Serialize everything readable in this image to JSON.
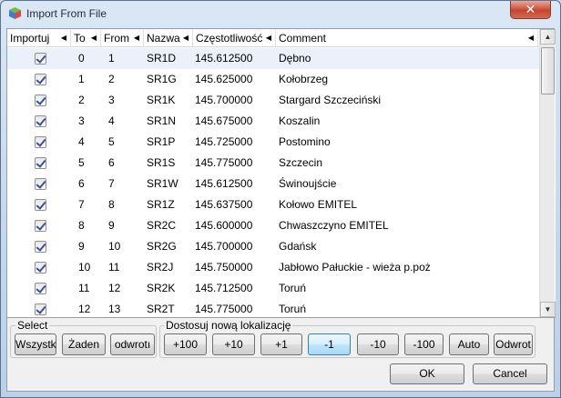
{
  "window": {
    "title": "Import From File",
    "close_glyph": "✕"
  },
  "table": {
    "columns": [
      "Importuj",
      "To",
      "From",
      "Nazwa",
      "Częstotliwość",
      "Comment"
    ],
    "rows": [
      {
        "to": "0",
        "from": "1",
        "name": "SR1D",
        "freq": "145.612500",
        "comment": "Dębno"
      },
      {
        "to": "1",
        "from": "2",
        "name": "SR1G",
        "freq": "145.625000",
        "comment": "Kołobrzeg"
      },
      {
        "to": "2",
        "from": "3",
        "name": "SR1K",
        "freq": "145.700000",
        "comment": "Stargard Szczeciński"
      },
      {
        "to": "3",
        "from": "4",
        "name": "SR1N",
        "freq": "145.675000",
        "comment": "Koszalin"
      },
      {
        "to": "4",
        "from": "5",
        "name": "SR1P",
        "freq": "145.725000",
        "comment": "Postomino"
      },
      {
        "to": "5",
        "from": "6",
        "name": "SR1S",
        "freq": "145.775000",
        "comment": "Szczecin"
      },
      {
        "to": "6",
        "from": "7",
        "name": "SR1W",
        "freq": "145.612500",
        "comment": "Świnoujście"
      },
      {
        "to": "7",
        "from": "8",
        "name": "SR1Z",
        "freq": "145.637500",
        "comment": "Kołowo EMITEL"
      },
      {
        "to": "8",
        "from": "9",
        "name": "SR2C",
        "freq": "145.600000",
        "comment": "Chwaszczyno EMITEL"
      },
      {
        "to": "9",
        "from": "10",
        "name": "SR2G",
        "freq": "145.700000",
        "comment": "Gdańsk"
      },
      {
        "to": "10",
        "from": "11",
        "name": "SR2J",
        "freq": "145.750000",
        "comment": "Jabłowo Pałuckie - wieża p.poż"
      },
      {
        "to": "11",
        "from": "12",
        "name": "SR2K",
        "freq": "145.712500",
        "comment": "Toruń"
      },
      {
        "to": "12",
        "from": "13",
        "name": "SR2T",
        "freq": "145.775000",
        "comment": "Toruń"
      }
    ]
  },
  "select_group": {
    "label": "Select",
    "buttons": [
      "Wszystk",
      "Żaden",
      "odwrotı"
    ]
  },
  "adjust_group": {
    "label": "Dostosuj nową lokalizację",
    "buttons": [
      "+100",
      "+10",
      "+1",
      "-1",
      "-10",
      "-100",
      "Auto",
      "Odwrot"
    ],
    "active_index": 3
  },
  "dialog": {
    "ok": "OK",
    "cancel": "Cancel"
  }
}
